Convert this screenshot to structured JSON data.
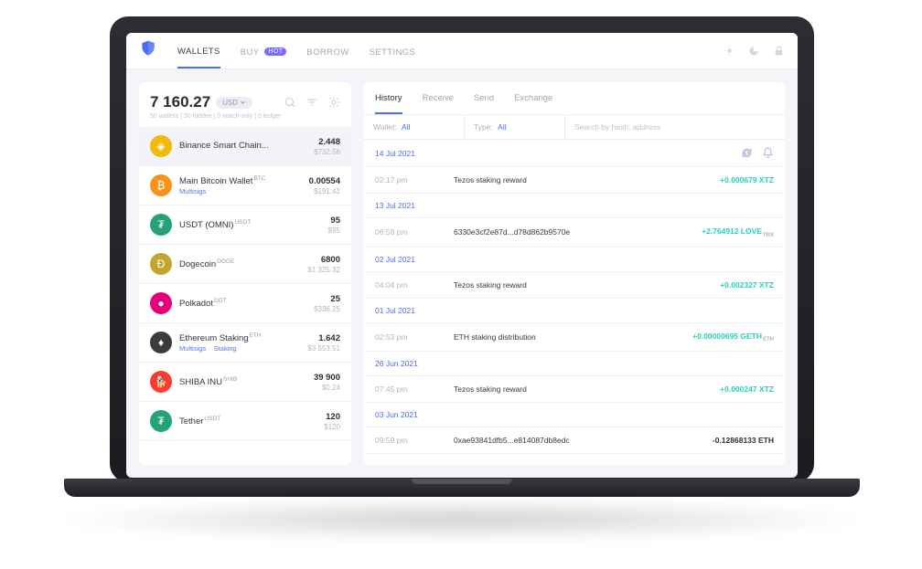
{
  "nav": {
    "items": [
      "WALLETS",
      "BUY",
      "BORROW",
      "SETTINGS"
    ],
    "buy_badge": "HOT"
  },
  "balance": {
    "amount": "7 160.27",
    "currency_label": "USD",
    "meta": "50 wallets | 30 hidden | 0 watch only | 0 ledger"
  },
  "wallets": [
    {
      "name": "Binance Smart Chain...",
      "tag": "",
      "meta": "",
      "amt": "2.448",
      "fiat": "$732.56",
      "color": "#f0b90b",
      "letter": "◈",
      "sel": true
    },
    {
      "name": "Main Bitcoin Wallet",
      "tag": "BTC",
      "meta": "Multisigs",
      "amt": "0.00554",
      "fiat": "$191.41",
      "color": "#f7931a",
      "letter": "₿"
    },
    {
      "name": "USDT (OMNI)",
      "tag": "USDT",
      "meta": "",
      "amt": "95",
      "fiat": "$95",
      "color": "#26a17b",
      "letter": "₮"
    },
    {
      "name": "Dogecoin",
      "tag": "DOGE",
      "meta": "",
      "amt": "6800",
      "fiat": "$1 325.32",
      "color": "#c2a633",
      "letter": "Ð"
    },
    {
      "name": "Polkadot",
      "tag": "DOT",
      "meta": "",
      "amt": "25",
      "fiat": "$336.25",
      "color": "#e6007a",
      "letter": "●"
    },
    {
      "name": "Ethereum Staking",
      "tag": "ETH",
      "meta": "Multisigs · Staking",
      "amt": "1.642",
      "fiat": "$3 553.51",
      "color": "#3c3c3d",
      "letter": "♦"
    },
    {
      "name": "SHIBA INU",
      "tag": "SHIB",
      "meta": "",
      "amt": "39 900",
      "fiat": "$0.24",
      "color": "#ff3b2f",
      "letter": "🐕"
    },
    {
      "name": "Tether",
      "tag": "USDT",
      "meta": "",
      "amt": "120",
      "fiat": "$120",
      "color": "#26a17b",
      "letter": "₮"
    }
  ],
  "tx_tabs": [
    "History",
    "Receive",
    "Send",
    "Exchange"
  ],
  "filters": {
    "wallet_label": "Wallet:",
    "wallet_value": "All",
    "type_label": "Type:",
    "type_value": "All",
    "search_placeholder": "Search by hash, address"
  },
  "tx": [
    {
      "kind": "date",
      "date": "14 Jul 2021",
      "first": true
    },
    {
      "kind": "tx",
      "time": "02:17 pm",
      "desc": "Tezos staking reward",
      "amt": "+0.000679 XTZ",
      "pos": true
    },
    {
      "kind": "date",
      "date": "13 Jul 2021"
    },
    {
      "kind": "tx",
      "time": "06:58 pm",
      "desc": "6330e3cf2e87d...d78d862b9570e",
      "amt": "+2.764912 LOVE",
      "pos": true,
      "sub": "TRX"
    },
    {
      "kind": "date",
      "date": "02 Jul 2021"
    },
    {
      "kind": "tx",
      "time": "04:04 pm",
      "desc": "Tezos staking reward",
      "amt": "+0.002327 XTZ",
      "pos": true
    },
    {
      "kind": "date",
      "date": "01 Jul 2021"
    },
    {
      "kind": "tx",
      "time": "02:53 pm",
      "desc": "ETH staking distribution",
      "amt": "+0.00000695 GETH",
      "pos": true,
      "sub": "ETH"
    },
    {
      "kind": "date",
      "date": "26 Jun 2021"
    },
    {
      "kind": "tx",
      "time": "07:45 pm",
      "desc": "Tezos staking reward",
      "amt": "+0.000247 XTZ",
      "pos": true
    },
    {
      "kind": "date",
      "date": "03 Jun 2021"
    },
    {
      "kind": "tx",
      "time": "09:59 pm",
      "desc": "0xae93841dfb5...e814087db8edc",
      "amt": "-0.12868133 ETH",
      "pos": false
    }
  ]
}
